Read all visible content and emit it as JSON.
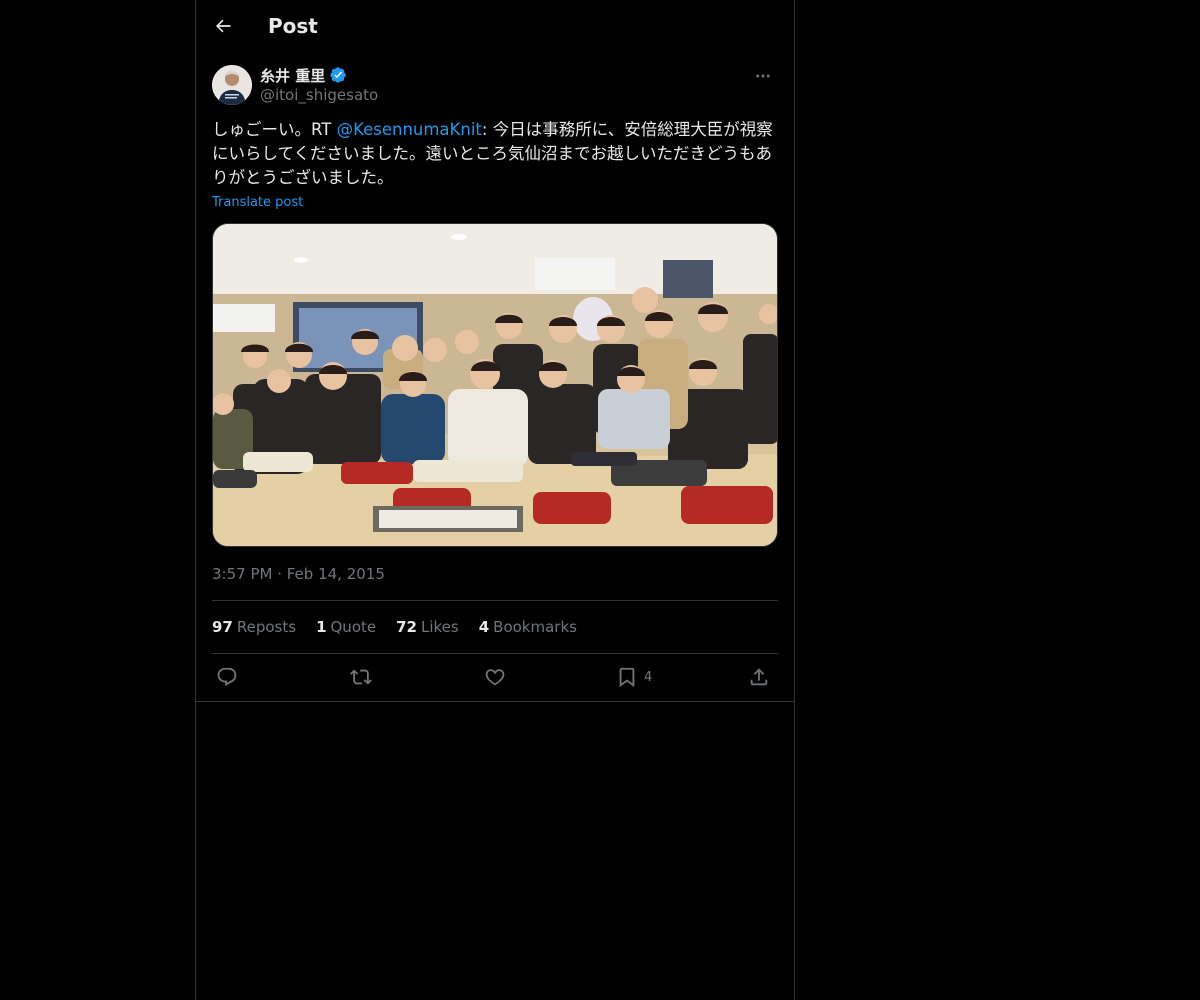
{
  "header": {
    "title": "Post",
    "back_icon": "arrow-left-icon"
  },
  "author": {
    "name": "糸井 重里",
    "handle": "@itoi_shigesato",
    "verified": true,
    "verified_color": "#1d9bf0"
  },
  "post": {
    "text_before": "しゅごーい。RT ",
    "mention": "@KesennumaKnit",
    "text_after": ": 今日は事務所に、安倍総理大臣が視察にいらしてくださいました。遠いところ気仙沼までお越しいただきどうもありがとうございました。",
    "translate_label": "Translate post",
    "timestamp": "3:57 PM · Feb 14, 2015"
  },
  "stats": [
    {
      "count": "97",
      "label": "Reposts"
    },
    {
      "count": "1",
      "label": "Quote"
    },
    {
      "count": "72",
      "label": "Likes"
    },
    {
      "count": "4",
      "label": "Bookmarks"
    }
  ],
  "actions": {
    "reply_icon": "reply-icon",
    "repost_icon": "repost-icon",
    "like_icon": "heart-icon",
    "bookmark_icon": "bookmark-icon",
    "bookmark_count": "4",
    "share_icon": "share-icon"
  },
  "colors": {
    "background": "#000000",
    "border": "#2f3336",
    "accent": "#1d9bf0",
    "muted": "#71767b",
    "text": "#e7e9ea"
  }
}
